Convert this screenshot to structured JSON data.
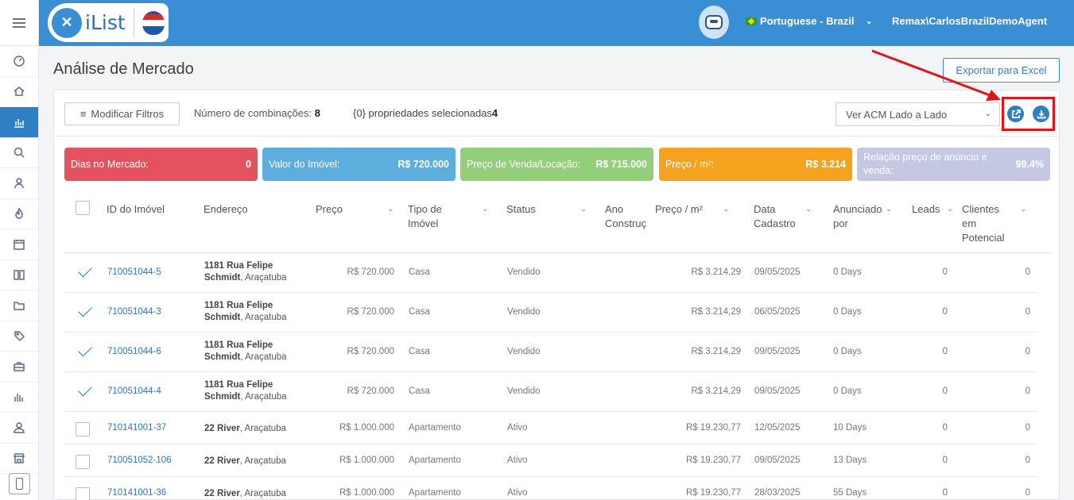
{
  "header": {
    "brand": "iList",
    "language": "Portuguese - Brazil",
    "user": "Remax\\CarlosBrazilDemoAgent"
  },
  "sidebar": {
    "icons": [
      "dashboard-icon",
      "home-icon",
      "chart-icon",
      "search-icon",
      "contacts-icon",
      "hot-icon",
      "calendar-icon",
      "book-icon",
      "folder-icon",
      "tag-icon",
      "briefcase-icon",
      "bar-chart-icon",
      "user-icon",
      "store-icon"
    ],
    "active_index": 2
  },
  "page": {
    "title": "Análise de Mercado",
    "export_label": "Exportar para Excel"
  },
  "filters": {
    "modify_label": "Modificar Filtros",
    "combos_label": "Número de combinações:",
    "combos_value": "8",
    "selected_label": "{0} propriedades selecionadas",
    "selected_value": "4",
    "acm_view": "Ver ACM Lado a Lado"
  },
  "stats": [
    {
      "label": "Dias no Mercado:",
      "value": "0",
      "color": "#e5525f"
    },
    {
      "label": "Valor do Imóvel:",
      "value": "R$ 720.000",
      "color": "#5eaedd"
    },
    {
      "label": "Preço de Venda/Locação:",
      "value": "R$ 715.000",
      "color": "#93cf7a"
    },
    {
      "label": "Preço / m²:",
      "value": "R$ 3.214",
      "color": "#f5a31f"
    },
    {
      "label": "Relação preço de anúncio e venda:",
      "value": "99.4%",
      "color": "#c5c8e3"
    }
  ],
  "table": {
    "columns": [
      "ID do Imóvel",
      "Endereço",
      "Preço",
      "Tipo de Imóvel",
      "Status",
      "Ano Construção",
      "Preço / m²",
      "Data Cadastro",
      "Anunciado por",
      "Leads",
      "Clientes em Potencial"
    ],
    "col_visible": [
      "ID do Imóvel",
      "Endereço",
      "Preço",
      "Tipo de\nImóvel",
      "Status",
      "Ano\nConstruç",
      "Preço / m²",
      "Data\nCadastro",
      "Anunciado\npor",
      "Leads",
      "Clientes\nem\nPotencial"
    ],
    "rows": [
      {
        "checked": true,
        "id": "710051044-5",
        "street": "1181 Rua Felipe Schmidt",
        "city": ", Araçatuba",
        "price": "R$ 720.000",
        "type": "Casa",
        "status": "Vendido",
        "ppm": "R$ 3.214,29",
        "date": "09/05/2025",
        "days": "0 Days",
        "leads": "0",
        "clients": "0"
      },
      {
        "checked": true,
        "id": "710051044-3",
        "street": "1181 Rua Felipe Schmidt",
        "city": ", Araçatuba",
        "price": "R$ 720.000",
        "type": "Casa",
        "status": "Vendido",
        "ppm": "R$ 3.214,29",
        "date": "06/05/2025",
        "days": "0 Days",
        "leads": "0",
        "clients": "0"
      },
      {
        "checked": true,
        "id": "710051044-6",
        "street": "1181 Rua Felipe Schmidt",
        "city": ", Araçatuba",
        "price": "R$ 720.000",
        "type": "Casa",
        "status": "Vendido",
        "ppm": "R$ 3.214,29",
        "date": "09/05/2025",
        "days": "0 Days",
        "leads": "0",
        "clients": "0"
      },
      {
        "checked": true,
        "id": "710051044-4",
        "street": "1181 Rua Felipe Schmidt",
        "city": ", Araçatuba",
        "price": "R$ 720.000",
        "type": "Casa",
        "status": "Vendido",
        "ppm": "R$ 3.214,29",
        "date": "09/05/2025",
        "days": "0 Days",
        "leads": "0",
        "clients": "0"
      },
      {
        "checked": false,
        "id": "710141001-37",
        "street": "22 River",
        "city": ", Araçatuba",
        "price": "R$ 1.000.000",
        "type": "Apartamento",
        "status": "Ativo",
        "ppm": "R$ 19.230,77",
        "date": "12/05/2025",
        "days": "10 Days",
        "leads": "0",
        "clients": "0"
      },
      {
        "checked": false,
        "id": "710051052-106",
        "street": "22 River",
        "city": ", Araçatuba",
        "price": "R$ 1.000.000",
        "type": "Apartamento",
        "status": "Ativo",
        "ppm": "R$ 19.230,77",
        "date": "09/05/2025",
        "days": "13 Days",
        "leads": "0",
        "clients": "0"
      },
      {
        "checked": false,
        "id": "710141001-36",
        "street": "22 River",
        "city": ", Araçatuba",
        "price": "R$ 1.000.000",
        "type": "Apartamento",
        "status": "Ativo",
        "ppm": "R$ 19.230,77",
        "date": "28/03/2025",
        "days": "55 Days",
        "leads": "0",
        "clients": "0"
      }
    ]
  }
}
